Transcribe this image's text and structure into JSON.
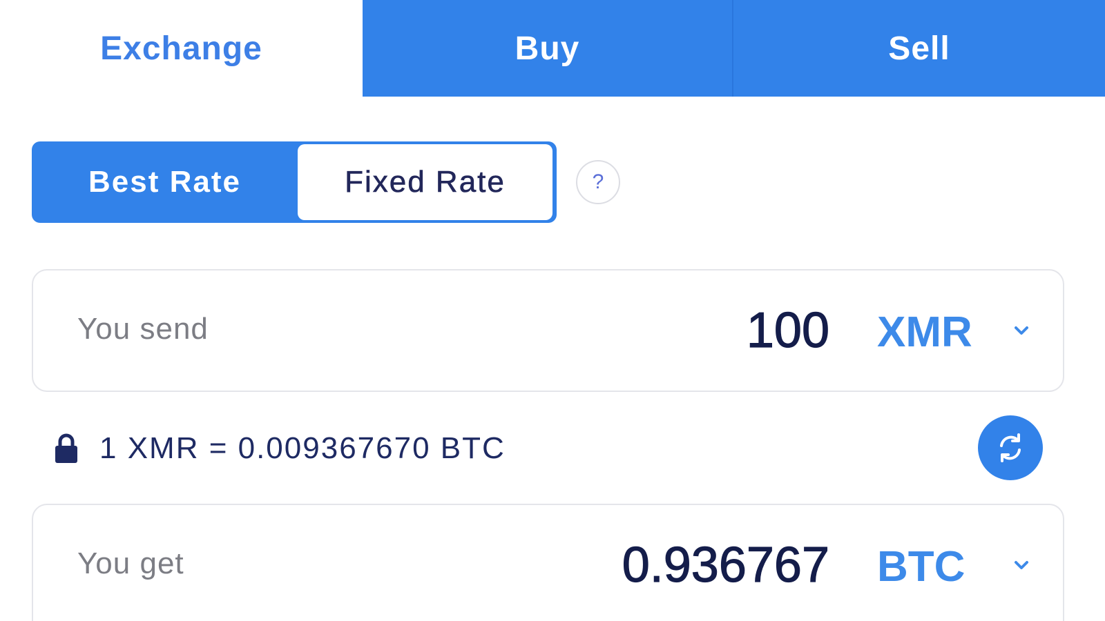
{
  "tabs": [
    {
      "label": "Exchange",
      "active": true
    },
    {
      "label": "Buy",
      "active": false
    },
    {
      "label": "Sell",
      "active": false
    }
  ],
  "rate_toggle": {
    "best_label": "Best Rate",
    "fixed_label": "Fixed Rate",
    "selected": "Fixed Rate",
    "help_glyph": "?"
  },
  "send": {
    "label": "You send",
    "amount": "100",
    "currency": "XMR"
  },
  "rate_info": {
    "text": "1 XMR = 0.009367670 BTC",
    "icon": "lock-icon"
  },
  "get": {
    "label": "You get",
    "amount": "0.936767",
    "currency": "BTC"
  },
  "colors": {
    "primary": "#3282e9",
    "dark_text": "#141d4a",
    "muted_text": "#7c7d84",
    "currency": "#3d8ae9"
  }
}
